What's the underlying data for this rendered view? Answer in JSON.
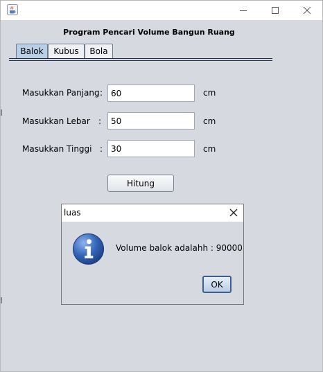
{
  "window": {
    "title": "",
    "icons": {
      "app": "java-cup-icon",
      "minimize": "minimize-icon",
      "maximize": "maximize-icon",
      "close": "close-icon"
    }
  },
  "form": {
    "heading": "Program Pencari Volume Bangun Ruang",
    "tabs": [
      {
        "label": "Balok",
        "active": true
      },
      {
        "label": "Kubus",
        "active": false
      },
      {
        "label": "Bola",
        "active": false
      }
    ],
    "fields": [
      {
        "label": "Masukkan Panjang",
        "value": "60",
        "unit": "cm"
      },
      {
        "label": "Masukkan Lebar",
        "value": "50",
        "unit": "cm"
      },
      {
        "label": "Masukkan Tinggi",
        "value": "30",
        "unit": "cm"
      }
    ],
    "colon": ":",
    "button_label": "Hitung"
  },
  "dialog": {
    "title": "luas",
    "message": "Volume balok adalahh : 90000",
    "ok_label": "OK",
    "icon": "info-icon"
  },
  "colors": {
    "background": "#d6d9df",
    "active_tab": "#b8cfe5",
    "info_icon": "#2c5aa8"
  }
}
